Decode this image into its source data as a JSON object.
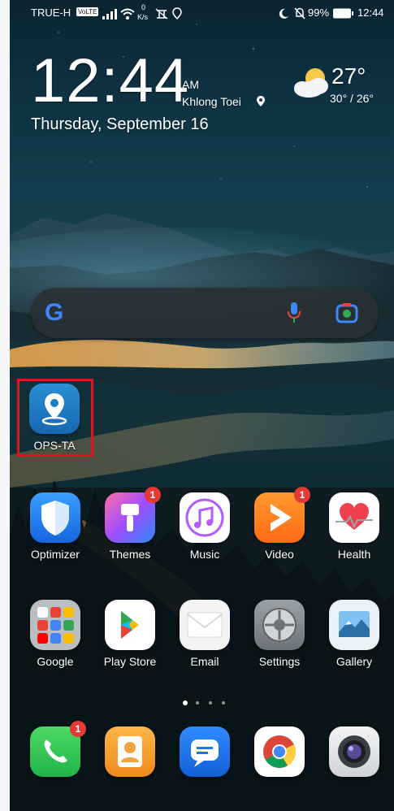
{
  "status_bar": {
    "carrier": "TRUE-H",
    "volte": "VoLTE",
    "speed_value": "0",
    "speed_unit": "K/s",
    "battery_percent": "99%",
    "time": "12:44"
  },
  "clock_widget": {
    "time": "12:44",
    "ampm": "AM",
    "location": "Khlong Toei",
    "date": "Thursday, September 16"
  },
  "weather": {
    "temperature": "27°",
    "range": "30° / 26°"
  },
  "search_bar": {
    "logo": "G"
  },
  "shortcut": {
    "label": "OPS-TA"
  },
  "apps_row1": [
    {
      "label": "Optimizer",
      "icon": "shield-icon"
    },
    {
      "label": "Themes",
      "icon": "paintbrush-icon",
      "badge": "1"
    },
    {
      "label": "Music",
      "icon": "music-note-icon"
    },
    {
      "label": "Video",
      "icon": "play-icon",
      "badge": "1"
    },
    {
      "label": "Health",
      "icon": "heart-icon"
    }
  ],
  "apps_row2": [
    {
      "label": "Google",
      "icon": "google-folder-icon"
    },
    {
      "label": "Play Store",
      "icon": "play-store-icon"
    },
    {
      "label": "Email",
      "icon": "envelope-icon"
    },
    {
      "label": "Settings",
      "icon": "gear-icon"
    },
    {
      "label": "Gallery",
      "icon": "landscape-icon"
    }
  ],
  "page_indicator": {
    "count": 4,
    "active": 1
  },
  "dock": [
    {
      "icon": "phone-icon",
      "badge": "1"
    },
    {
      "icon": "contacts-icon"
    },
    {
      "icon": "messages-icon"
    },
    {
      "icon": "chrome-icon"
    },
    {
      "icon": "camera-icon"
    }
  ]
}
